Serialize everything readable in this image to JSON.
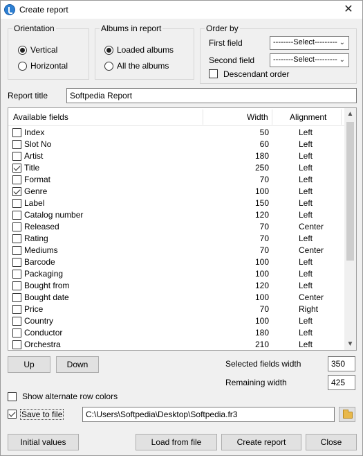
{
  "window": {
    "title": "Create report",
    "close_label": "✕"
  },
  "orientation": {
    "label": "Orientation",
    "options": [
      {
        "label": "Vertical",
        "selected": true
      },
      {
        "label": "Horizontal",
        "selected": false
      }
    ]
  },
  "albums": {
    "label": "Albums in report",
    "options": [
      {
        "label": "Loaded albums",
        "selected": true
      },
      {
        "label": "All the albums",
        "selected": false
      }
    ]
  },
  "order_by": {
    "label": "Order by",
    "first_field_label": "First field",
    "first_field_value": "--------Select---------",
    "second_field_label": "Second field",
    "second_field_value": "--------Select---------",
    "descendant_label": "Descendant order",
    "descendant_checked": false
  },
  "report_title": {
    "label": "Report title",
    "value": "Softpedia Report"
  },
  "fields_list": {
    "headers": {
      "name": "Available fields",
      "width": "Width",
      "alignment": "Alignment"
    },
    "rows": [
      {
        "name": "Index",
        "width": "50",
        "alignment": "Left",
        "checked": false
      },
      {
        "name": "Slot No",
        "width": "60",
        "alignment": "Left",
        "checked": false
      },
      {
        "name": "Artist",
        "width": "180",
        "alignment": "Left",
        "checked": false
      },
      {
        "name": "Title",
        "width": "250",
        "alignment": "Left",
        "checked": true
      },
      {
        "name": "Format",
        "width": "70",
        "alignment": "Left",
        "checked": false
      },
      {
        "name": "Genre",
        "width": "100",
        "alignment": "Left",
        "checked": true
      },
      {
        "name": "Label",
        "width": "150",
        "alignment": "Left",
        "checked": false
      },
      {
        "name": "Catalog number",
        "width": "120",
        "alignment": "Left",
        "checked": false
      },
      {
        "name": "Released",
        "width": "70",
        "alignment": "Center",
        "checked": false
      },
      {
        "name": "Rating",
        "width": "70",
        "alignment": "Left",
        "checked": false
      },
      {
        "name": "Mediums",
        "width": "70",
        "alignment": "Center",
        "checked": false
      },
      {
        "name": "Barcode",
        "width": "100",
        "alignment": "Left",
        "checked": false
      },
      {
        "name": "Packaging",
        "width": "100",
        "alignment": "Left",
        "checked": false
      },
      {
        "name": "Bought from",
        "width": "120",
        "alignment": "Left",
        "checked": false
      },
      {
        "name": "Bought date",
        "width": "100",
        "alignment": "Center",
        "checked": false
      },
      {
        "name": "Price",
        "width": "70",
        "alignment": "Right",
        "checked": false
      },
      {
        "name": "Country",
        "width": "100",
        "alignment": "Left",
        "checked": false
      },
      {
        "name": "Conductor",
        "width": "180",
        "alignment": "Left",
        "checked": false
      },
      {
        "name": "Orchestra",
        "width": "210",
        "alignment": "Left",
        "checked": false
      }
    ]
  },
  "buttons": {
    "up": "Up",
    "down": "Down",
    "initial_values": "Initial values",
    "load_from_file": "Load from file",
    "create_report": "Create report",
    "close": "Close"
  },
  "widths": {
    "selected_label": "Selected fields width",
    "selected_value": "350",
    "remaining_label": "Remaining width",
    "remaining_value": "425"
  },
  "options": {
    "alternate_rows_label": "Show alternate row colors",
    "alternate_rows_checked": false,
    "save_to_file_label": "Save to file",
    "save_to_file_checked": true,
    "file_path": "C:\\Users\\Softpedia\\Desktop\\Softpedia.fr3"
  },
  "icons": {
    "app": "music-note-icon",
    "folder": "folder-open-icon"
  }
}
